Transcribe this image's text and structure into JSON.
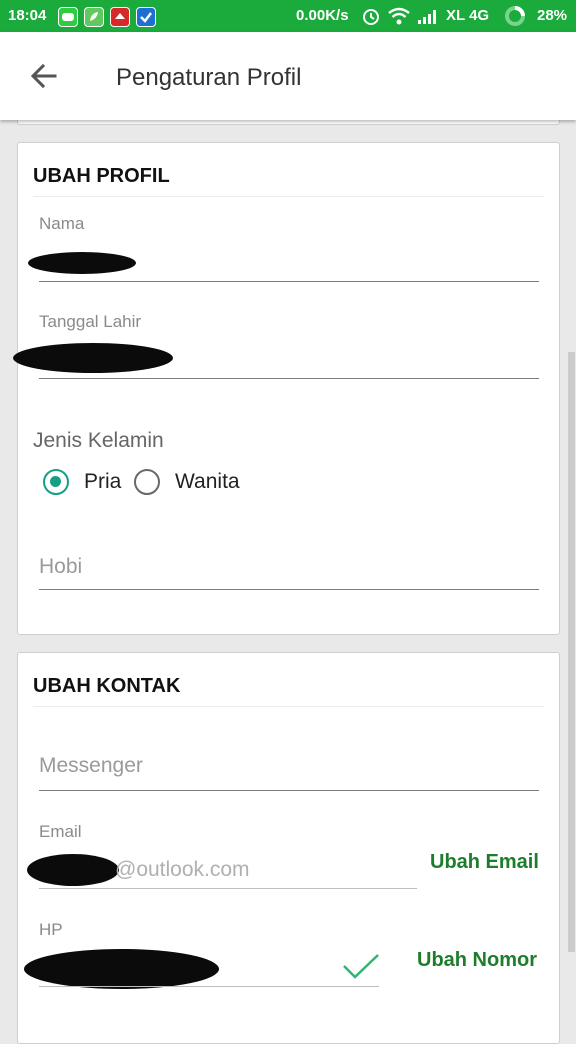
{
  "statusbar": {
    "time": "18:04",
    "speed": "0.00K/s",
    "carrier": "XL 4G",
    "battery": "28%",
    "app_icons": [
      "line-icon",
      "leaf-app-icon",
      "red-app-icon",
      "check-app-icon"
    ],
    "system_icons": [
      "alarm-icon",
      "wifi-icon",
      "signal-icon",
      "battery-ring-icon"
    ]
  },
  "appbar": {
    "title": "Pengaturan Profil",
    "back_icon": "arrow-back-icon"
  },
  "profile": {
    "title": "UBAH PROFIL",
    "nama_label": "Nama",
    "tanggal_label": "Tanggal Lahir",
    "gender_label": "Jenis Kelamin",
    "gender_options": [
      "Pria",
      "Wanita"
    ],
    "gender_selected": "Pria",
    "hobi_placeholder": "Hobi"
  },
  "contact": {
    "title": "UBAH KONTAK",
    "messenger_placeholder": "Messenger",
    "email_label": "Email",
    "email_visible": "@outlook.com",
    "email_action": "Ubah Email",
    "hp_label": "HP",
    "hp_action": "Ubah Nomor",
    "verified_icon": "checkmark-icon"
  },
  "colors": {
    "statusbar": "#1aab3c",
    "radio_accent": "#15a085",
    "link_green": "#1e7d2c",
    "check_green": "#2bb673"
  }
}
